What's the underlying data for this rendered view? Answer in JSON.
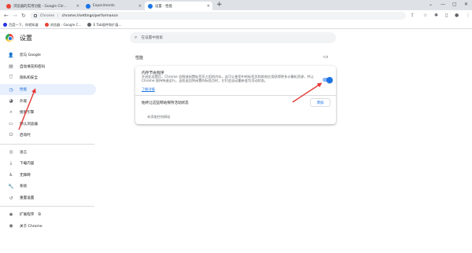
{
  "tabs": [
    {
      "title": "浏览器的实用功能 - Google Chr...",
      "active": false,
      "favicon_color": "#ea4335"
    },
    {
      "title": "Experiments",
      "active": false,
      "favicon_color": "#1a73e8"
    },
    {
      "title": "设置 - 性能",
      "active": true,
      "favicon_color": "#1a73e8"
    }
  ],
  "toolbar": {
    "site_label": "Chrome",
    "url": "chrome://settings/performance"
  },
  "bookmarks": [
    {
      "label": "百度一下，你就知道",
      "color": "#2932e1"
    },
    {
      "label": "浏览器 - Google C...",
      "color": "#ea4335"
    },
    {
      "label": "E Tab插件和扩展...",
      "color": "#5f6368"
    }
  ],
  "header": {
    "title": "设置",
    "search_placeholder": "在设置中搜索"
  },
  "sidebar": {
    "items": [
      {
        "label": "您与 Google",
        "icon": "person-icon",
        "glyph": "👤"
      },
      {
        "label": "自动填充和密码",
        "icon": "autofill-icon",
        "glyph": "▤"
      },
      {
        "label": "隐私和安全",
        "icon": "shield-icon",
        "glyph": "⛉"
      },
      {
        "label": "性能",
        "icon": "speedometer-icon",
        "glyph": "◷",
        "selected": true
      },
      {
        "label": "外观",
        "icon": "palette-icon",
        "glyph": "◕"
      },
      {
        "label": "搜索引擎",
        "icon": "search-icon",
        "glyph": "⌕"
      },
      {
        "label": "默认浏览器",
        "icon": "browser-icon",
        "glyph": "▭"
      },
      {
        "label": "启动时",
        "icon": "power-icon",
        "glyph": "⏻"
      }
    ],
    "items2": [
      {
        "label": "语言",
        "icon": "globe-icon",
        "glyph": "◎"
      },
      {
        "label": "下载内容",
        "icon": "download-icon",
        "glyph": "⤓"
      },
      {
        "label": "无障碍",
        "icon": "accessibility-icon",
        "glyph": "♿"
      },
      {
        "label": "系统",
        "icon": "wrench-icon",
        "glyph": "🔧"
      },
      {
        "label": "重置设置",
        "icon": "reset-icon",
        "glyph": "↺"
      }
    ],
    "items3": [
      {
        "label": "扩展程序",
        "icon": "puzzle-icon",
        "glyph": "✱"
      },
      {
        "label": "关于 Chrome",
        "icon": "chrome-icon",
        "glyph": "◉"
      }
    ]
  },
  "main": {
    "section_title": "性能",
    "memory_saver_title": "内存节省程序",
    "memory_saver_desc": "开启此设置后，Chrome 会释放闲置标签页占用的内存，这可让使用中的标签页和其他应用获得更多计算机资源，并让 Chrome 保持快速运行。当您返回到闲置的标签页时，它们会自动重新变为活动状态。",
    "learn_more": "了解详情",
    "memory_saver_on": true,
    "always_active_label": "始终让这些网站保持活动状态",
    "add_button": "添加",
    "no_sites": "未添加任何网站"
  },
  "colors": {
    "accent": "#1a73e8",
    "annotation": "#e53935"
  }
}
